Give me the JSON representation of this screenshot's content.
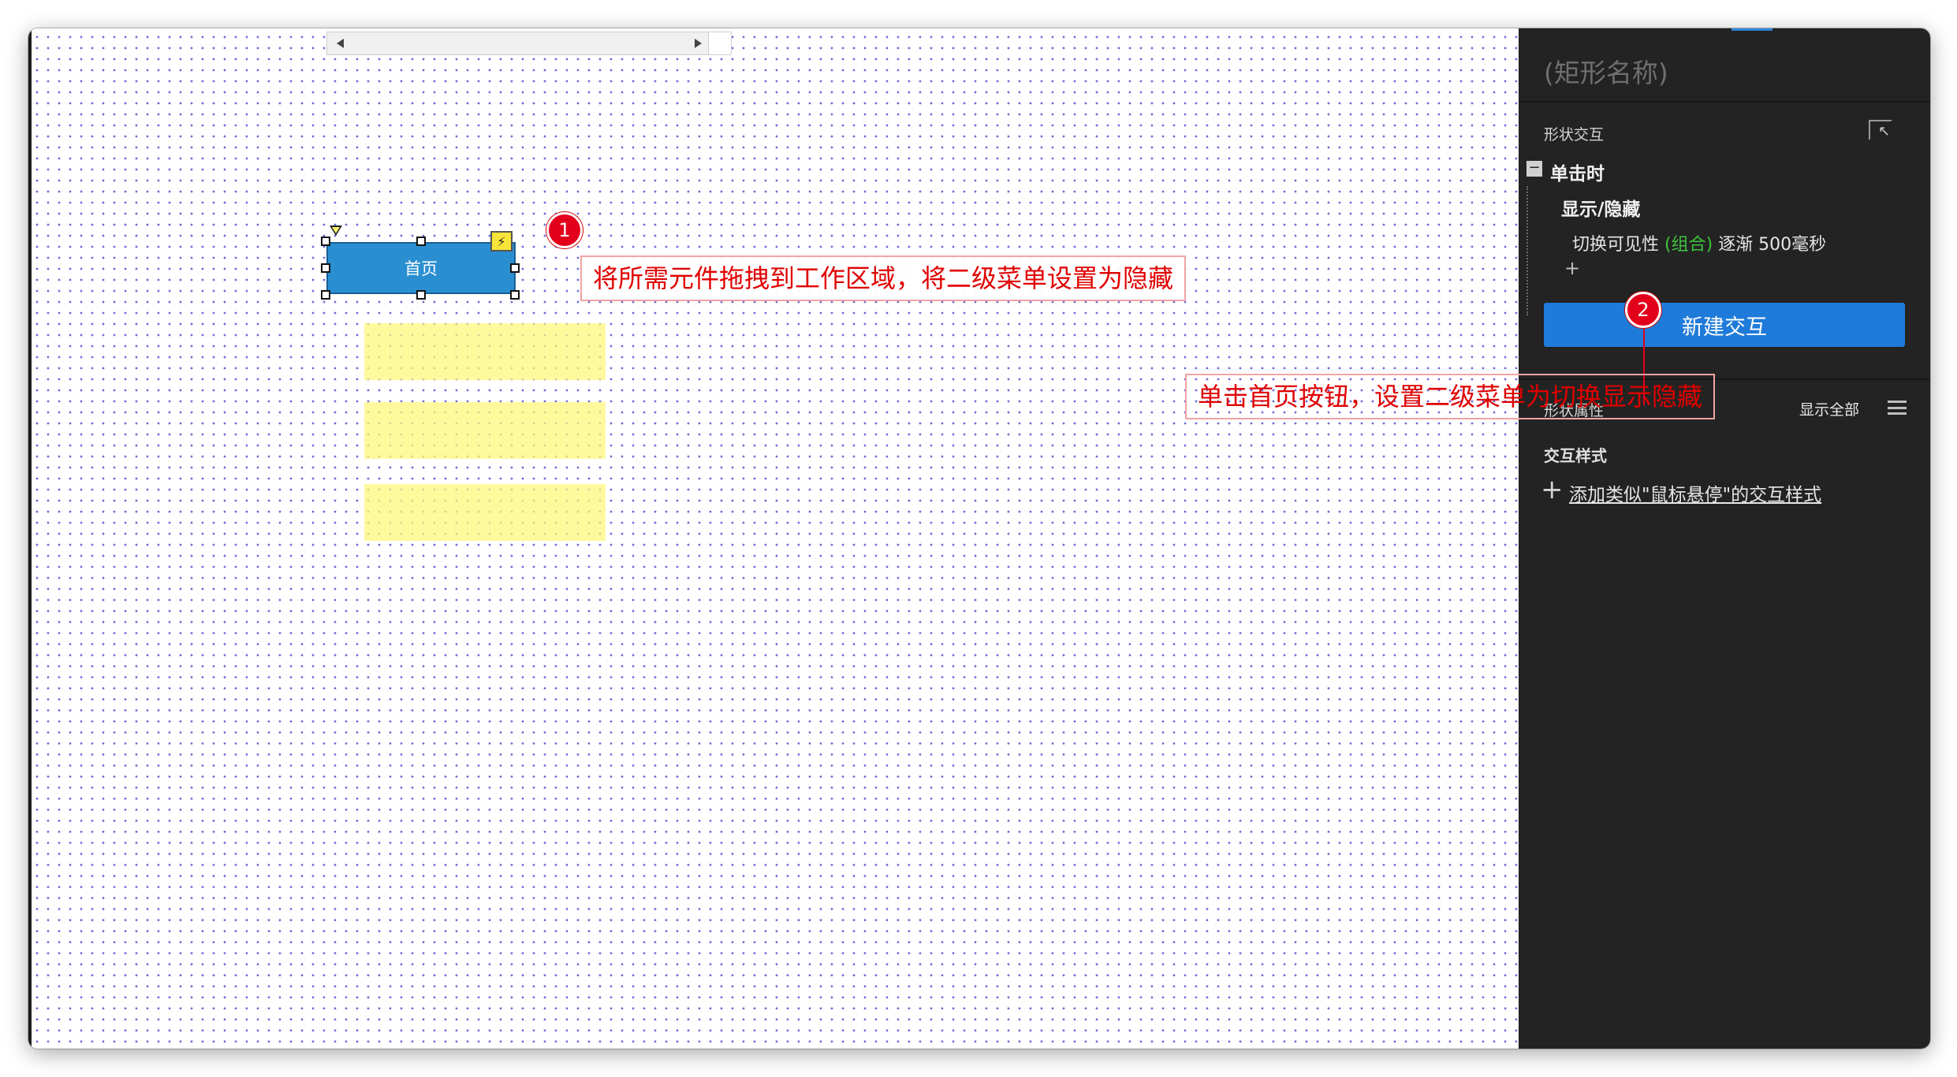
{
  "canvas": {
    "home_button_label": "首页",
    "submenu_count": 3
  },
  "annotations": {
    "step1": {
      "number": "1",
      "text": "将所需元件拖拽到工作区域，将二级菜单设置为隐藏"
    },
    "step2": {
      "number": "2",
      "text": "单击首页按钮，设置二级菜单为切换显示隐藏"
    }
  },
  "panel": {
    "shape_name_placeholder": "(矩形名称)",
    "interactions_title": "形状交互",
    "event": "单击时",
    "case": "显示/隐藏",
    "action": {
      "verb": "切换可见性",
      "target": "(组合)",
      "animation": "逐渐 500毫秒"
    },
    "add_action": "+",
    "new_interaction_button": "新建交互",
    "properties_title": "形状属性",
    "show_all": "显示全部",
    "interaction_styles_title": "交互样式",
    "add_style_plus": "+",
    "add_style_link": "添加类似\"鼠标悬停\"的交互样式"
  },
  "colors": {
    "button_blue": "#2a8fd1",
    "submenu_yellow": "#fff678",
    "annotation_red": "#e3001b",
    "panel_bg": "#232323",
    "primary_button": "#1f7bd9",
    "target_green": "#3cc43c"
  },
  "icons": [
    "lightning-icon",
    "pick-widget-icon",
    "collapse-icon",
    "hamburger-menu-icon",
    "scroll-left-icon",
    "scroll-right-icon"
  ]
}
